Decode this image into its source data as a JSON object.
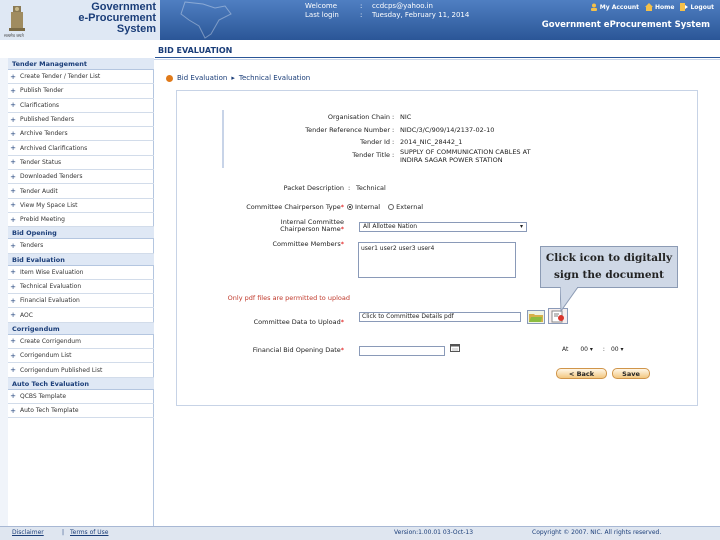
{
  "header": {
    "brand_line1": "Government",
    "brand_line2": "e-Procurement",
    "brand_line3": "System",
    "emblem_caption": "सत्यमेव जयते",
    "welcome_label": "Welcome",
    "welcome_value": "ccdcps@yahoo.in",
    "last_login_label": "Last login",
    "last_login_value": "Tuesday, February 11, 2014",
    "separator": ":",
    "links": [
      "My Account",
      "Home",
      "Logout"
    ],
    "system_title": "Government eProcurement System",
    "colors": {
      "header_blue": "#2b5697",
      "brand_blue": "#1a3d78"
    }
  },
  "page": {
    "heading": "BID EVALUATION"
  },
  "breadcrumb": [
    "Bid Evaluation",
    "Technical Evaluation"
  ],
  "sidebar": {
    "sections": [
      {
        "title": "Tender Management",
        "items": [
          {
            "label": "Create Tender / Tender List",
            "bullet": "+"
          },
          {
            "label": "Publish Tender",
            "bullet": "+"
          },
          {
            "label": "Clarifications",
            "bullet": "+"
          },
          {
            "label": "Published Tenders",
            "bullet": "+"
          },
          {
            "label": "Archive Tenders",
            "bullet": "+"
          },
          {
            "label": "Archived Clarifications",
            "bullet": "+"
          },
          {
            "label": "Tender Status",
            "bullet": "+"
          },
          {
            "label": "Downloaded Tenders",
            "bullet": "+"
          },
          {
            "label": "Tender Audit",
            "bullet": "+"
          },
          {
            "label": "View My Space List",
            "bullet": "+"
          },
          {
            "label": "Prebid Meeting",
            "bullet": "+"
          }
        ]
      },
      {
        "title": "Bid Opening",
        "items": [
          {
            "label": "Tenders",
            "bullet": "+"
          }
        ]
      },
      {
        "title": "Bid Evaluation",
        "items": [
          {
            "label": "Item Wise Evaluation",
            "bullet": "+"
          },
          {
            "label": "Technical Evaluation",
            "bullet": "+"
          },
          {
            "label": "Financial Evaluation",
            "bullet": "+"
          },
          {
            "label": "AOC",
            "bullet": "+"
          }
        ]
      },
      {
        "title": "Corrigendum",
        "items": [
          {
            "label": "Create Corrigendum",
            "bullet": "+"
          },
          {
            "label": "Corrigendum List",
            "bullet": "+"
          },
          {
            "label": "Corrigendum Published List",
            "bullet": "+"
          }
        ]
      },
      {
        "title": "Auto Tech Evaluation",
        "items": [
          {
            "label": "QCBS Template",
            "bullet": "+"
          },
          {
            "label": "Auto Tech Template",
            "bullet": "+"
          }
        ]
      }
    ]
  },
  "form": {
    "org_chain_label": "Organisation Chain",
    "org_chain_value": "NIC",
    "tender_ref_label": "Tender Reference Number",
    "tender_ref_value": "NIDC/3/C/909/14/2137-02-10",
    "tender_id_label": "Tender Id",
    "tender_id_value": "2014_NIC_28442_1",
    "tender_title_label": "Tender Title",
    "tender_title_value": "SUPPLY OF COMMUNICATION CABLES AT INDIRA SAGAR POWER STATION",
    "packet_desc_label": "Packet Description",
    "packet_desc_value": "Technical",
    "committee_type_label": "Committee Chairperson Type",
    "committee_type_options": [
      "Internal",
      "External"
    ],
    "internal_chair_label_1": "Internal Committee",
    "internal_chair_label_2": "Chairperson Name",
    "internal_chair_value": "All Allottee Nation",
    "members_label": "Committee Members",
    "members_value": "user1 user2 user3 user4",
    "pdf_note": "Only pdf files are permitted to upload",
    "upload_label": "Committee Data to Upload",
    "upload_value": "Click to Committee Details pdf",
    "fin_date_label": "Financial Bid Opening Date",
    "at_label": "At",
    "hh_value": "00",
    "mm_value": "00",
    "back_button": "< Back",
    "save_button": "Save"
  },
  "callout": {
    "line1": "Click icon to digitally",
    "line2": "sign the document"
  },
  "footer": {
    "disclaimer": "Disclaimer",
    "divider": "|",
    "terms": "Terms of Use",
    "version": "Version:1.00.01 03-Oct-13",
    "copyright": "Copyright © 2007. NIC. All rights reserved."
  }
}
